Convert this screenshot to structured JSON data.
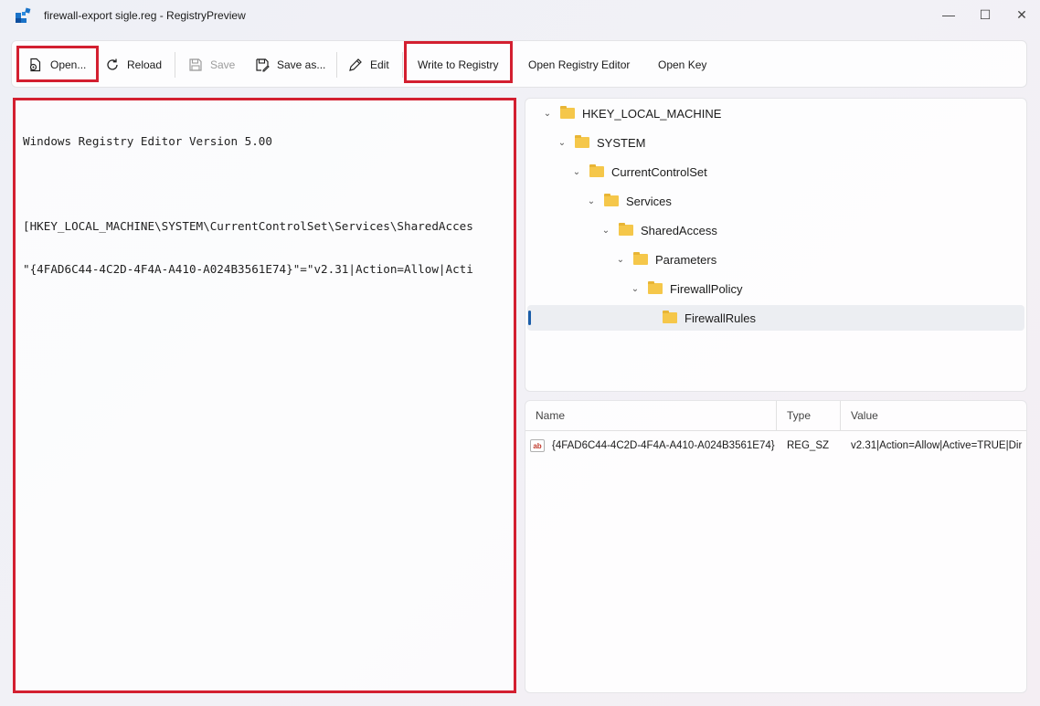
{
  "window": {
    "title": "firewall-export sigle.reg - RegistryPreview",
    "controls": {
      "minimize": "—",
      "maximize": "☐",
      "close": "✕"
    }
  },
  "toolbar": {
    "open_label": "Open...",
    "reload_label": "Reload",
    "save_label": "Save",
    "save_as_label": "Save as...",
    "edit_label": "Edit",
    "write_label": "Write to Registry",
    "open_editor_label": "Open Registry Editor",
    "open_key_label": "Open Key"
  },
  "editor": {
    "lines": [
      "Windows Registry Editor Version 5.00",
      "",
      "[HKEY_LOCAL_MACHINE\\SYSTEM\\CurrentControlSet\\Services\\SharedAcces",
      "\"{4FAD6C44-4C2D-4F4A-A410-A024B3561E74}\"=\"v2.31|Action=Allow|Acti"
    ]
  },
  "tree": {
    "items": [
      {
        "label": "HKEY_LOCAL_MACHINE",
        "expanded": true
      },
      {
        "label": "SYSTEM",
        "expanded": true
      },
      {
        "label": "CurrentControlSet",
        "expanded": true
      },
      {
        "label": "Services",
        "expanded": true
      },
      {
        "label": "SharedAccess",
        "expanded": true
      },
      {
        "label": "Parameters",
        "expanded": true
      },
      {
        "label": "FirewallPolicy",
        "expanded": true
      },
      {
        "label": "FirewallRules",
        "expanded": false,
        "selected": true
      }
    ]
  },
  "values_table": {
    "headers": {
      "name": "Name",
      "type": "Type",
      "value": "Value"
    },
    "rows": [
      {
        "icon": "string-value-icon",
        "icon_text": "ab",
        "name": "{4FAD6C44-4C2D-4F4A-A410-A024B3561E74}",
        "type": "REG_SZ",
        "value": "v2.31|Action=Allow|Active=TRUE|Dir"
      }
    ]
  },
  "colors": {
    "highlight_box": "#d31f30",
    "selection_accent": "#1c5ea9",
    "folder": "#f5c74a"
  }
}
